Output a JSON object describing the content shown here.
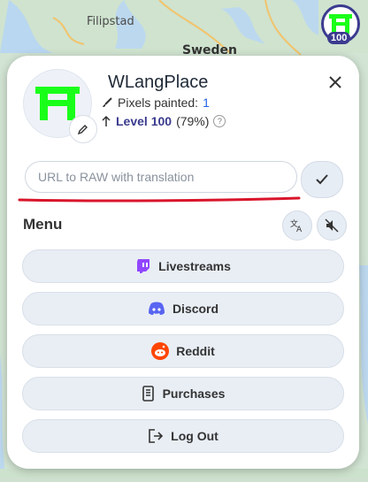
{
  "map": {
    "city_label": "Filipstad",
    "country_label": "Sweden"
  },
  "profile_badge": {
    "level_text": "100"
  },
  "profile": {
    "username": "WLangPlace",
    "pixels_label": "Pixels painted:",
    "pixels_value": "1",
    "level_label": "Level 100",
    "level_percent": "(79%)",
    "help_mark": "?"
  },
  "translation": {
    "url_placeholder": "URL to RAW with translation",
    "url_value": ""
  },
  "menu": {
    "title": "Menu",
    "items": [
      {
        "label": "Livestreams",
        "icon": "twitch-icon"
      },
      {
        "label": "Discord",
        "icon": "discord-icon"
      },
      {
        "label": "Reddit",
        "icon": "reddit-icon"
      },
      {
        "label": "Purchases",
        "icon": "receipt-icon"
      },
      {
        "label": "Log Out",
        "icon": "logout-icon"
      }
    ]
  },
  "colors": {
    "accent": "#3b3b8f",
    "link_blue": "#2563eb",
    "logo_green": "#1aff1a",
    "twitch": "#9146ff",
    "discord": "#5865f2",
    "reddit": "#ff4500",
    "underline_red": "#d9152b"
  }
}
